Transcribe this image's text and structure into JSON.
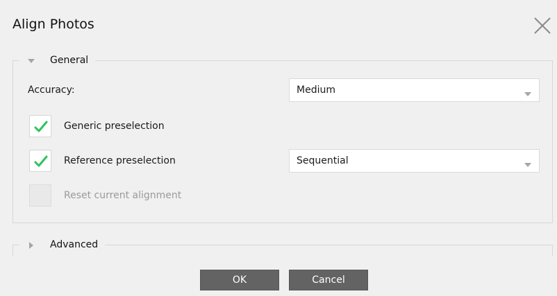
{
  "dialog": {
    "title": "Align Photos",
    "close_icon": "close-icon"
  },
  "general": {
    "label": "General",
    "expanded": true,
    "accuracy_label": "Accuracy:",
    "accuracy_value": "Medium",
    "generic_preselection_label": "Generic preselection",
    "generic_preselection_checked": true,
    "reference_preselection_label": "Reference preselection",
    "reference_preselection_checked": true,
    "reference_preselection_value": "Sequential",
    "reset_alignment_label": "Reset current alignment",
    "reset_alignment_checked": false,
    "reset_alignment_enabled": false
  },
  "advanced": {
    "label": "Advanced",
    "expanded": false
  },
  "buttons": {
    "ok_label": "OK",
    "cancel_label": "Cancel"
  },
  "colors": {
    "check": "#2ec35a",
    "button": "#636363",
    "background": "#f0f0f0"
  }
}
